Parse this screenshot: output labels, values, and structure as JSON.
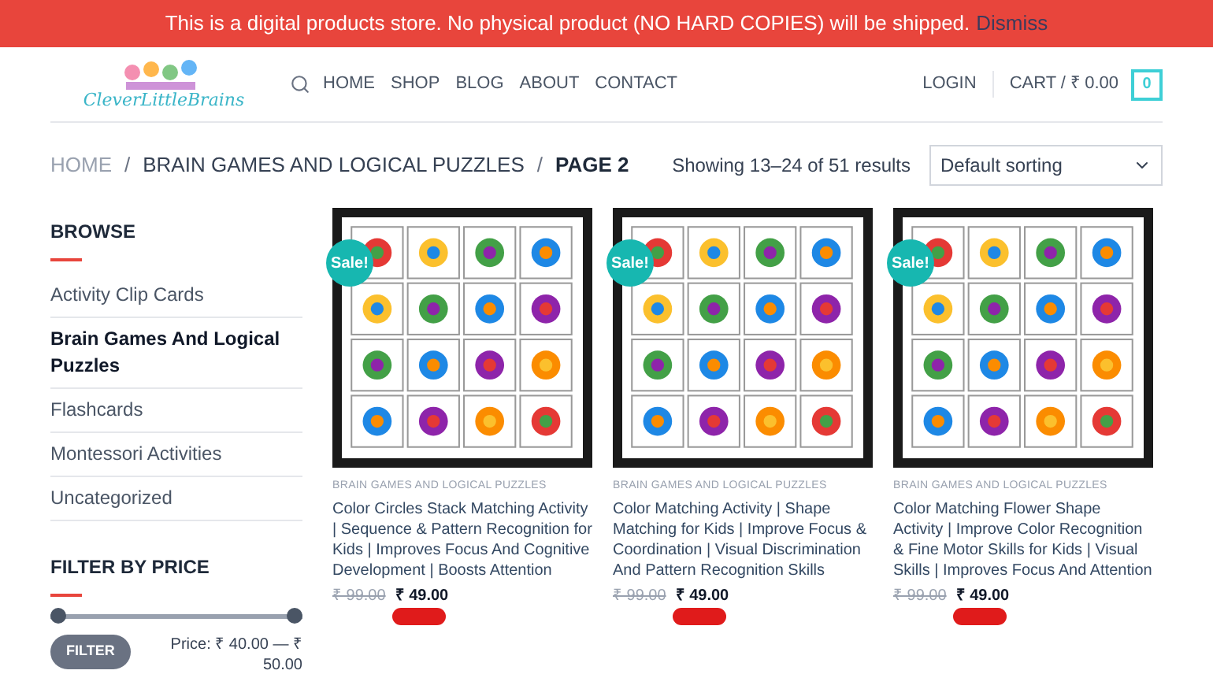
{
  "notice": {
    "text": "This is a digital products store. No physical product (NO HARD COPIES) will be shipped.",
    "dismiss": "Dismiss"
  },
  "logo": {
    "text": "CleverLittleBrains"
  },
  "nav": [
    "HOME",
    "SHOP",
    "BLOG",
    "ABOUT",
    "CONTACT"
  ],
  "account": {
    "login": "LOGIN",
    "cart": "CART / ₹ 0.00",
    "cart_count": "0"
  },
  "breadcrumb": {
    "items": [
      "HOME",
      "BRAIN GAMES AND LOGICAL PUZZLES"
    ],
    "separator": "/",
    "current": "PAGE 2"
  },
  "result_count": "Showing 13–24 of 51 results",
  "sorting": {
    "value": "Default sorting"
  },
  "sidebar": {
    "browse_title": "BROWSE",
    "categories": [
      {
        "label": "Activity Clip Cards",
        "selected": false
      },
      {
        "label": "Brain Games And Logical Puzzles",
        "selected": true
      },
      {
        "label": "Flashcards",
        "selected": false
      },
      {
        "label": "Montessori Activities",
        "selected": false
      },
      {
        "label": "Uncategorized",
        "selected": false
      }
    ],
    "filter_title": "FILTER BY PRICE",
    "price_slider": {
      "low": {
        "level": 0
      },
      "high": {
        "level": 1
      }
    },
    "filter_button": "FILTER",
    "price_range": "Price: ₹ 40.00 — ₹ 50.00"
  },
  "products": [
    {
      "badge": "Sale!",
      "category": "BRAIN GAMES AND LOGICAL PUZZLES",
      "title": "Color Circles Stack Matching Activity | Sequence & Pattern Recognition for Kids | Improves Focus And Cognitive Development | Boosts Attention",
      "old_price": "₹ 99.00",
      "price": "₹ 49.00"
    },
    {
      "badge": "Sale!",
      "category": "BRAIN GAMES AND LOGICAL PUZZLES",
      "title": "Color Matching Activity | Shape Matching for Kids | Improve Focus & Coordination | Visual Discrimination And Pattern Recognition Skills",
      "old_price": "₹ 99.00",
      "price": "₹ 49.00"
    },
    {
      "badge": "Sale!",
      "category": "BRAIN GAMES AND LOGICAL PUZZLES",
      "title": "Color Matching Flower Shape Activity | Improve Color Recognition & Fine Motor Skills for Kids | Visual Skills | Improves Focus And Attention",
      "old_price": "₹ 99.00",
      "price": "₹ 49.00"
    }
  ]
}
